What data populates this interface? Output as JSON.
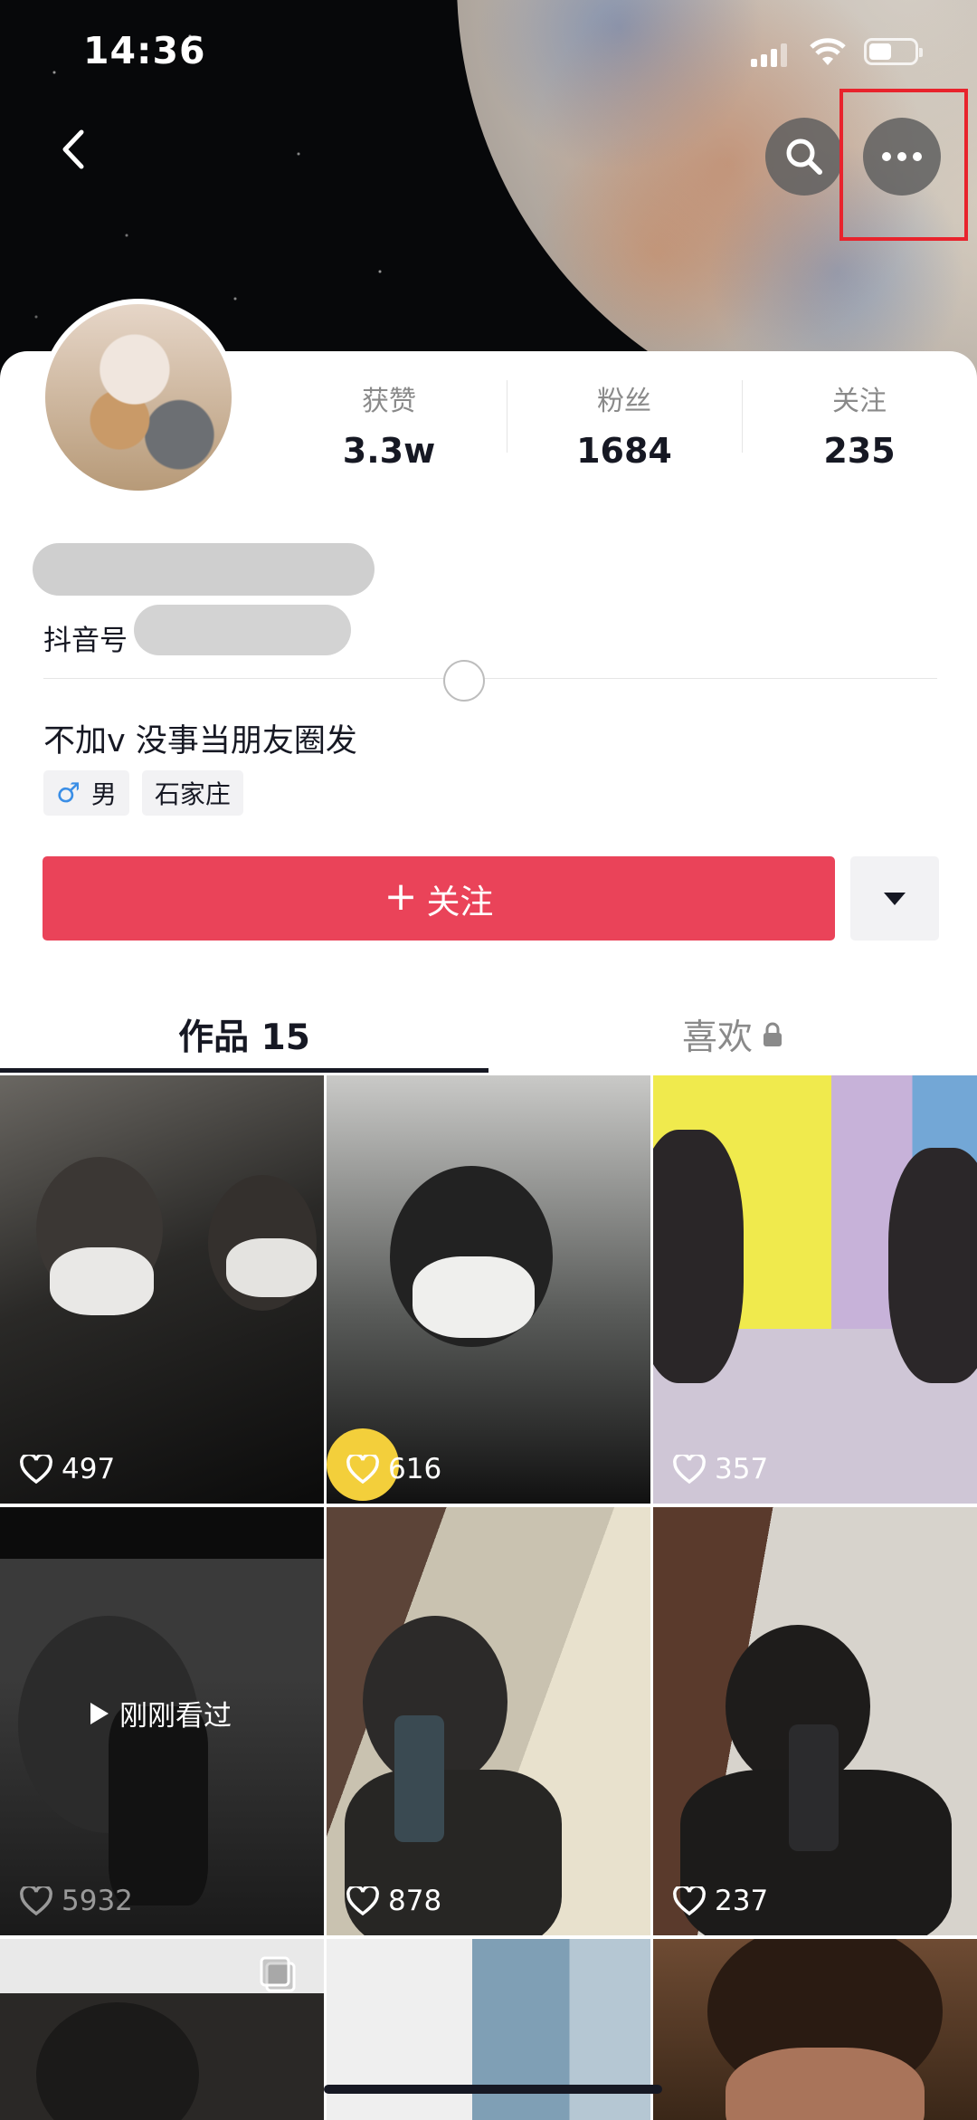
{
  "status_bar": {
    "time": "14:36"
  },
  "profile": {
    "stats": [
      {
        "label": "获赞",
        "value": "3.3w"
      },
      {
        "label": "粉丝",
        "value": "1684"
      },
      {
        "label": "关注",
        "value": "235"
      }
    ],
    "douyin_id_label": "抖音号",
    "bio": "不加v 没事当朋友圈发",
    "tags": {
      "gender_symbol": "♂",
      "gender": "男",
      "location": "石家庄"
    },
    "follow_label": "关注"
  },
  "tabs": {
    "works": "作品 15",
    "likes": "喜欢"
  },
  "videos": [
    {
      "likes": "497"
    },
    {
      "likes": "616"
    },
    {
      "likes": "357"
    },
    {
      "likes": "5932",
      "overlay": "刚刚看过"
    },
    {
      "likes": "878"
    },
    {
      "likes": "237"
    }
  ],
  "colors": {
    "follow": "#ea4359",
    "highlight": "#e8232c",
    "text": "#161823"
  },
  "icons": [
    "back-icon",
    "search-icon",
    "more-icon",
    "heart-icon",
    "lock-icon",
    "play-icon",
    "caret-down-icon",
    "male-icon"
  ]
}
